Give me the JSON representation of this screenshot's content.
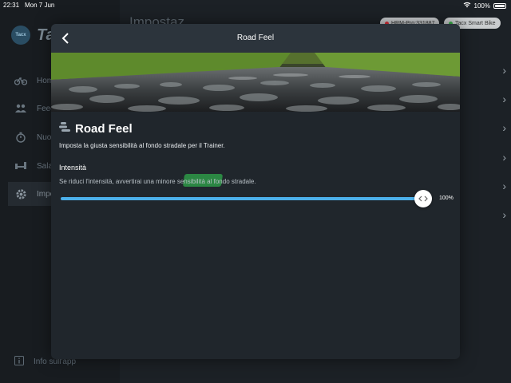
{
  "status_bar": {
    "time": "22:31",
    "date": "Mon 7 Jun",
    "battery": "100%"
  },
  "sidebar": {
    "logo_badge": "Tacx",
    "logo_text": "Ta",
    "items": [
      {
        "label": "Hom",
        "icon": "bike-icon"
      },
      {
        "label": "Feed",
        "icon": "people-icon"
      },
      {
        "label": "Nuov",
        "icon": "timer-icon"
      },
      {
        "label": "Sala",
        "icon": "dumbbell-icon"
      },
      {
        "label": "Impo",
        "icon": "gear-icon",
        "active": true
      }
    ],
    "bottom_item": "Info sull'app"
  },
  "main": {
    "title": "Impostaz",
    "chips": [
      {
        "label": "HRM-Pro:331887",
        "dot_color": "#e0303a"
      },
      {
        "label": "Tacx Smart Bike",
        "dot_color": "#3ab04a"
      }
    ]
  },
  "modal": {
    "title": "Road Feel",
    "heading": "Road Feel",
    "description": "Imposta la giusta sensibilità al fondo stradale per il Trainer.",
    "intensity": {
      "label": "Intensità",
      "description": "Se riduci l'intensità, avvertirai una minore sensibilità al fondo stradale.",
      "value": 100,
      "value_label": "100%"
    }
  },
  "colors": {
    "accent": "#4cb0ea",
    "highlight": "#2ea04a",
    "modal_bg": "#20262c",
    "header_bg": "#2c343c"
  }
}
